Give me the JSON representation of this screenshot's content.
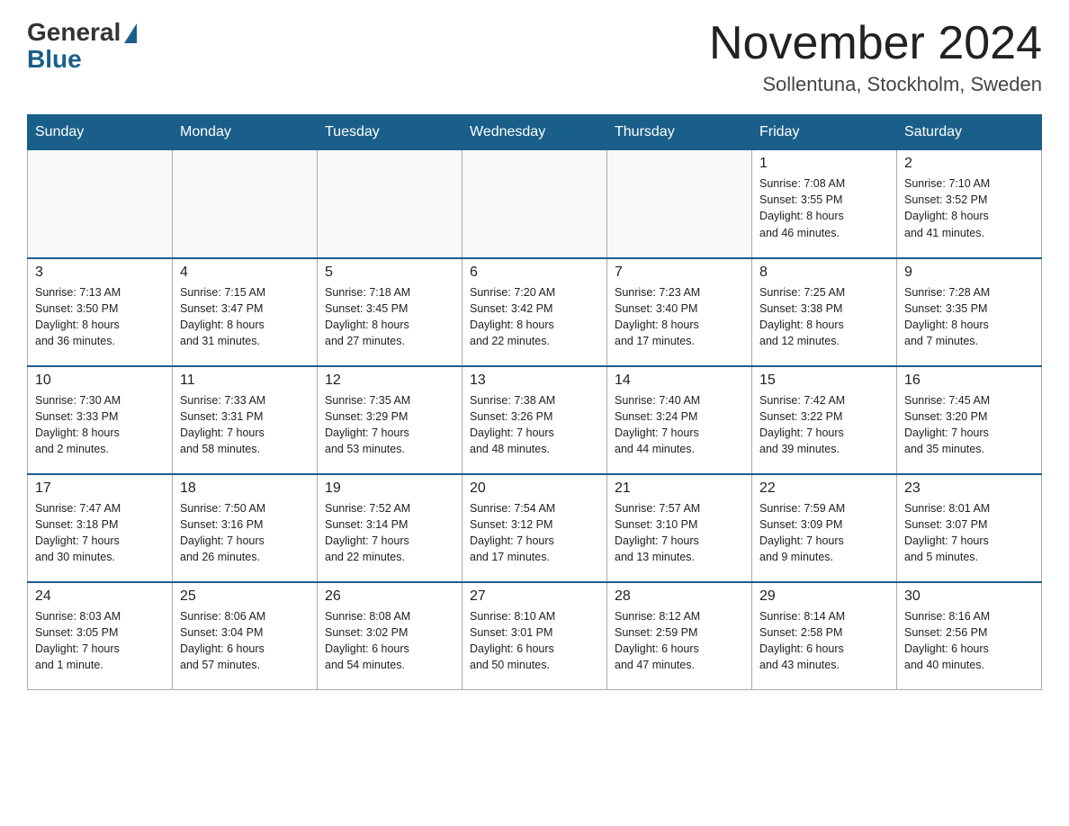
{
  "header": {
    "logo_general": "General",
    "logo_blue": "Blue",
    "month_title": "November 2024",
    "location": "Sollentuna, Stockholm, Sweden"
  },
  "days_of_week": [
    "Sunday",
    "Monday",
    "Tuesday",
    "Wednesday",
    "Thursday",
    "Friday",
    "Saturday"
  ],
  "weeks": [
    [
      {
        "day": "",
        "info": ""
      },
      {
        "day": "",
        "info": ""
      },
      {
        "day": "",
        "info": ""
      },
      {
        "day": "",
        "info": ""
      },
      {
        "day": "",
        "info": ""
      },
      {
        "day": "1",
        "info": "Sunrise: 7:08 AM\nSunset: 3:55 PM\nDaylight: 8 hours\nand 46 minutes."
      },
      {
        "day": "2",
        "info": "Sunrise: 7:10 AM\nSunset: 3:52 PM\nDaylight: 8 hours\nand 41 minutes."
      }
    ],
    [
      {
        "day": "3",
        "info": "Sunrise: 7:13 AM\nSunset: 3:50 PM\nDaylight: 8 hours\nand 36 minutes."
      },
      {
        "day": "4",
        "info": "Sunrise: 7:15 AM\nSunset: 3:47 PM\nDaylight: 8 hours\nand 31 minutes."
      },
      {
        "day": "5",
        "info": "Sunrise: 7:18 AM\nSunset: 3:45 PM\nDaylight: 8 hours\nand 27 minutes."
      },
      {
        "day": "6",
        "info": "Sunrise: 7:20 AM\nSunset: 3:42 PM\nDaylight: 8 hours\nand 22 minutes."
      },
      {
        "day": "7",
        "info": "Sunrise: 7:23 AM\nSunset: 3:40 PM\nDaylight: 8 hours\nand 17 minutes."
      },
      {
        "day": "8",
        "info": "Sunrise: 7:25 AM\nSunset: 3:38 PM\nDaylight: 8 hours\nand 12 minutes."
      },
      {
        "day": "9",
        "info": "Sunrise: 7:28 AM\nSunset: 3:35 PM\nDaylight: 8 hours\nand 7 minutes."
      }
    ],
    [
      {
        "day": "10",
        "info": "Sunrise: 7:30 AM\nSunset: 3:33 PM\nDaylight: 8 hours\nand 2 minutes."
      },
      {
        "day": "11",
        "info": "Sunrise: 7:33 AM\nSunset: 3:31 PM\nDaylight: 7 hours\nand 58 minutes."
      },
      {
        "day": "12",
        "info": "Sunrise: 7:35 AM\nSunset: 3:29 PM\nDaylight: 7 hours\nand 53 minutes."
      },
      {
        "day": "13",
        "info": "Sunrise: 7:38 AM\nSunset: 3:26 PM\nDaylight: 7 hours\nand 48 minutes."
      },
      {
        "day": "14",
        "info": "Sunrise: 7:40 AM\nSunset: 3:24 PM\nDaylight: 7 hours\nand 44 minutes."
      },
      {
        "day": "15",
        "info": "Sunrise: 7:42 AM\nSunset: 3:22 PM\nDaylight: 7 hours\nand 39 minutes."
      },
      {
        "day": "16",
        "info": "Sunrise: 7:45 AM\nSunset: 3:20 PM\nDaylight: 7 hours\nand 35 minutes."
      }
    ],
    [
      {
        "day": "17",
        "info": "Sunrise: 7:47 AM\nSunset: 3:18 PM\nDaylight: 7 hours\nand 30 minutes."
      },
      {
        "day": "18",
        "info": "Sunrise: 7:50 AM\nSunset: 3:16 PM\nDaylight: 7 hours\nand 26 minutes."
      },
      {
        "day": "19",
        "info": "Sunrise: 7:52 AM\nSunset: 3:14 PM\nDaylight: 7 hours\nand 22 minutes."
      },
      {
        "day": "20",
        "info": "Sunrise: 7:54 AM\nSunset: 3:12 PM\nDaylight: 7 hours\nand 17 minutes."
      },
      {
        "day": "21",
        "info": "Sunrise: 7:57 AM\nSunset: 3:10 PM\nDaylight: 7 hours\nand 13 minutes."
      },
      {
        "day": "22",
        "info": "Sunrise: 7:59 AM\nSunset: 3:09 PM\nDaylight: 7 hours\nand 9 minutes."
      },
      {
        "day": "23",
        "info": "Sunrise: 8:01 AM\nSunset: 3:07 PM\nDaylight: 7 hours\nand 5 minutes."
      }
    ],
    [
      {
        "day": "24",
        "info": "Sunrise: 8:03 AM\nSunset: 3:05 PM\nDaylight: 7 hours\nand 1 minute."
      },
      {
        "day": "25",
        "info": "Sunrise: 8:06 AM\nSunset: 3:04 PM\nDaylight: 6 hours\nand 57 minutes."
      },
      {
        "day": "26",
        "info": "Sunrise: 8:08 AM\nSunset: 3:02 PM\nDaylight: 6 hours\nand 54 minutes."
      },
      {
        "day": "27",
        "info": "Sunrise: 8:10 AM\nSunset: 3:01 PM\nDaylight: 6 hours\nand 50 minutes."
      },
      {
        "day": "28",
        "info": "Sunrise: 8:12 AM\nSunset: 2:59 PM\nDaylight: 6 hours\nand 47 minutes."
      },
      {
        "day": "29",
        "info": "Sunrise: 8:14 AM\nSunset: 2:58 PM\nDaylight: 6 hours\nand 43 minutes."
      },
      {
        "day": "30",
        "info": "Sunrise: 8:16 AM\nSunset: 2:56 PM\nDaylight: 6 hours\nand 40 minutes."
      }
    ]
  ]
}
